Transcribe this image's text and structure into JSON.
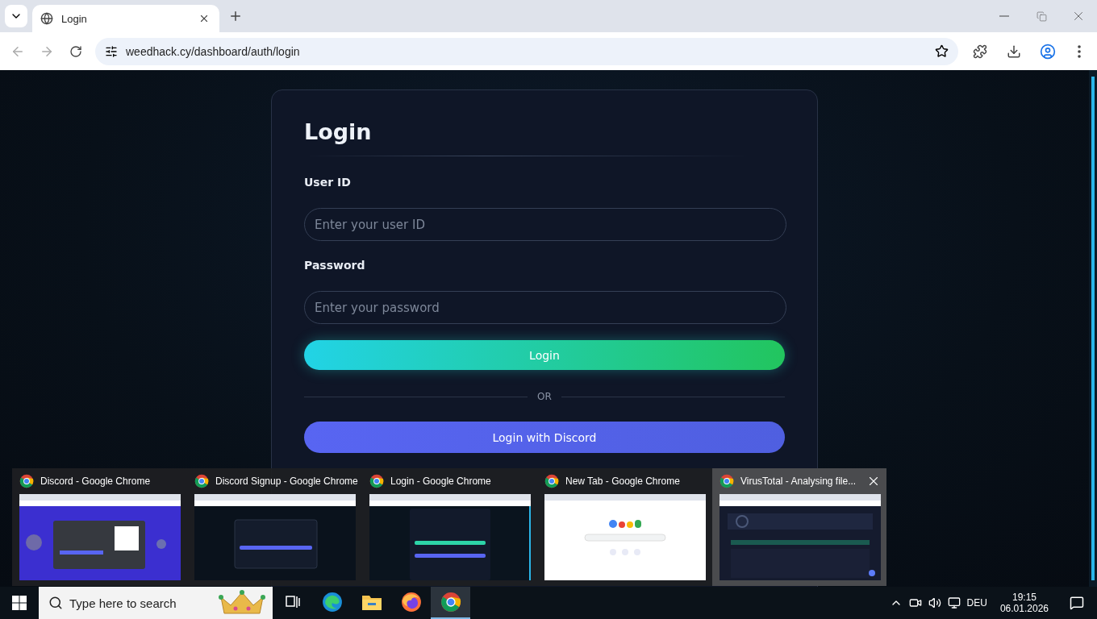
{
  "browser": {
    "tab_title": "Login",
    "url": "weedhack.cy/dashboard/auth/login"
  },
  "login": {
    "title": "Login",
    "fields": [
      {
        "label": "User ID",
        "placeholder": "Enter your user ID"
      },
      {
        "label": "Password",
        "placeholder": "Enter your password"
      }
    ],
    "submit": "Login",
    "divider": "OR",
    "discord_button": "Login with Discord"
  },
  "previews": [
    {
      "title": "Discord - Google Chrome",
      "kind": "discord",
      "selected": false
    },
    {
      "title": "Discord Signup - Google Chrome",
      "kind": "signup",
      "selected": false
    },
    {
      "title": "Login - Google Chrome",
      "kind": "login",
      "selected": false
    },
    {
      "title": "New Tab - Google Chrome",
      "kind": "newtab",
      "selected": false
    },
    {
      "title": "VirusTotal - Analysing file...",
      "kind": "virustotal",
      "selected": true
    }
  ],
  "taskbar": {
    "search_placeholder": "Type here to search",
    "apps": [
      {
        "kind": "taskview",
        "selected": false
      },
      {
        "kind": "edge",
        "selected": false
      },
      {
        "kind": "explorer",
        "selected": false
      },
      {
        "kind": "firefox",
        "selected": false
      },
      {
        "kind": "chrome",
        "selected": true
      }
    ],
    "language": "DEU",
    "time": "19:15",
    "date": "06.01.2026"
  }
}
